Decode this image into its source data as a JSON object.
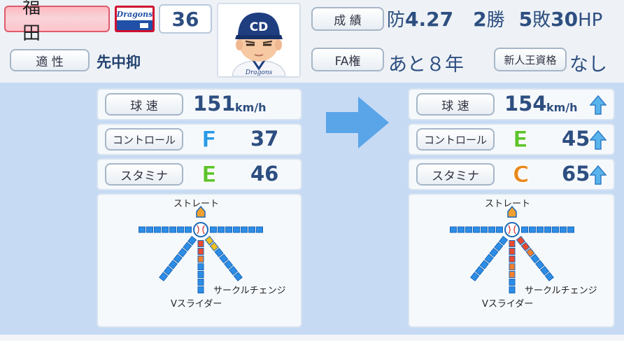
{
  "player": {
    "name": "福 田",
    "number": "36",
    "aptitude_label": "適 性",
    "aptitude_value": "先中抑"
  },
  "team_logo": {
    "text": "Dragons",
    "colors": [
      "#2050a8",
      "#d01030"
    ]
  },
  "record": {
    "label": "成 績",
    "era_label": "防",
    "era": "4.27",
    "wins": "2",
    "wins_unit": "勝",
    "losses": "5",
    "losses_unit": "敗",
    "hp": "30",
    "hp_unit": "HP"
  },
  "fa": {
    "label": "FA権",
    "value": "あと８年"
  },
  "rookie": {
    "label": "新人王資格",
    "value": "なし"
  },
  "before": {
    "speed_label": "球 速",
    "speed": "151",
    "speed_unit": "km/h",
    "control_label": "コントロール",
    "control_grade": "F",
    "control": "37",
    "stamina_label": "スタミナ",
    "stamina_grade": "E",
    "stamina": "46",
    "pitch_labels": {
      "top": "ストレート",
      "down": "Vスライダー",
      "downright": "サークルチェンジ"
    },
    "pitches": {
      "down": 3,
      "downright": 2
    }
  },
  "after": {
    "speed_label": "球 速",
    "speed": "154",
    "speed_unit": "km/h",
    "control_label": "コントロール",
    "control_grade": "E",
    "control": "45",
    "stamina_label": "スタミナ",
    "stamina_grade": "C",
    "stamina": "65",
    "pitch_labels": {
      "top": "ストレート",
      "down": "Vスライダー",
      "downright": "サークルチェンジ"
    },
    "pitches": {
      "down": 5,
      "downright": 3
    }
  },
  "colors": {
    "grade_F": "#2a9ae8",
    "grade_E": "#5cc42c",
    "grade_C": "#e8891c",
    "accent": "#2d4e80",
    "panel": "#c6daf4",
    "arrow": "#5aa4e8",
    "pitch_gauge": "#2d8de6",
    "pitch_fill_low": "#f0c020",
    "pitch_fill_mid": "#e84a30"
  }
}
